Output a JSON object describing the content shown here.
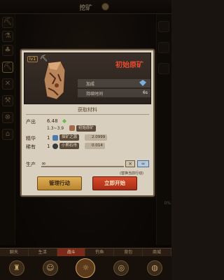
{
  "top": {
    "title": "挖矿"
  },
  "tabs": [
    "聊天",
    "生活",
    "战斗",
    "钓鱼",
    "背包",
    "商城"
  ],
  "right_col": {
    "percent": "0%"
  },
  "modal": {
    "level": "lv1",
    "ore_name": "初始原矿",
    "stats": [
      {
        "label": "加成",
        "value": ""
      },
      {
        "label": "持续时间",
        "value": "6s"
      }
    ],
    "section_title": "获取材料",
    "output": {
      "label": "产出",
      "value": "6.48",
      "range": "1.3~3.9",
      "item": "初始原矿"
    },
    "essence": {
      "label": "精华",
      "count": "1",
      "item": "探矿之源",
      "chance": "2.0999"
    },
    "rare": {
      "label": "稀有",
      "count": "1",
      "item": "小熊石市",
      "chance": "0.014"
    },
    "production": {
      "label": "生产",
      "value": "∞",
      "button": "∞"
    },
    "hint": "(替换当前行动)",
    "buttons": {
      "manage": "管理行动",
      "start": "立即开始"
    }
  },
  "colors": {
    "ore_name": "#e84a2e",
    "start_button": "#c23a20",
    "manage_button": "#d4a048"
  }
}
